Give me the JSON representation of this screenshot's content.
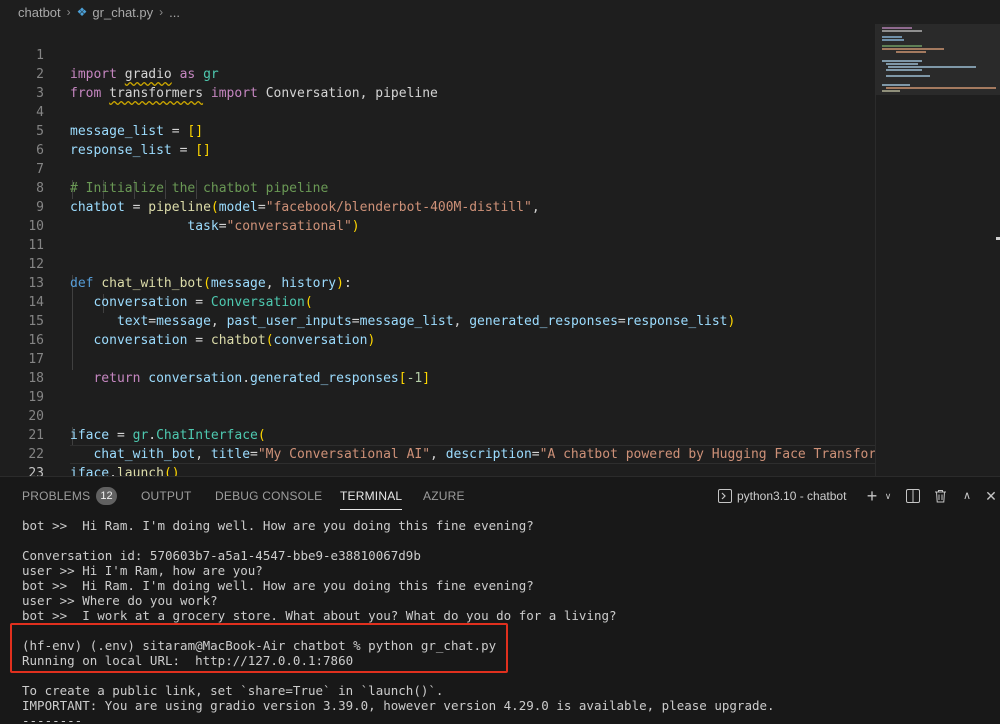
{
  "breadcrumb": {
    "folder": "chatbot",
    "file": "gr_chat.py",
    "more": "..."
  },
  "editor": {
    "active_line": 23,
    "lines": [
      {
        "n": "1"
      },
      {
        "n": "2"
      },
      {
        "n": "3"
      },
      {
        "n": "4"
      },
      {
        "n": "5"
      },
      {
        "n": "6"
      },
      {
        "n": "7"
      },
      {
        "n": "8"
      },
      {
        "n": "9"
      },
      {
        "n": "10"
      },
      {
        "n": "11"
      },
      {
        "n": "12"
      },
      {
        "n": "13"
      },
      {
        "n": "14"
      },
      {
        "n": "15"
      },
      {
        "n": "16"
      },
      {
        "n": "17"
      },
      {
        "n": "18"
      },
      {
        "n": "19"
      },
      {
        "n": "20"
      },
      {
        "n": "21"
      },
      {
        "n": "22"
      },
      {
        "n": "23"
      }
    ],
    "tokens": {
      "import": "import",
      "from": "from",
      "as": "as",
      "gradio": "gradio",
      "gr": "gr",
      "transformers": "transformers",
      "conv_pipeline": "Conversation, pipeline",
      "message_list": "message_list",
      "response_list": "response_list",
      "eq": " = ",
      "empty_list": "[]",
      "comment": "# Initialize the chatbot pipeline",
      "chatbot": "chatbot",
      "pipeline": "pipeline",
      "model_kw": "model",
      "model_val": "\"facebook/blenderbot-400M-distill\"",
      "task_kw": "task",
      "task_val": "\"conversational\"",
      "def": "def",
      "chat_with_bot": "chat_with_bot",
      "message": "message",
      "history": "history",
      "conversation": "conversation",
      "Conversation": "Conversation",
      "text_kw": "text",
      "past_kw": "past_user_inputs",
      "gen_kw": "generated_responses",
      "return": "return",
      "generated_responses": "generated_responses",
      "minus_one": "-1",
      "iface": "iface",
      "ChatInterface": "ChatInterface",
      "title_kw": "title",
      "title_val": "\"My Conversational AI\"",
      "desc_kw": "description",
      "desc_val": "\"A chatbot powered by Hugging Face Transforme",
      "launch": "launch"
    }
  },
  "panel": {
    "tabs": {
      "problems": "PROBLEMS",
      "problems_count": "12",
      "output": "OUTPUT",
      "debug_console": "DEBUG CONSOLE",
      "terminal": "TERMINAL",
      "azure": "AZURE"
    },
    "active_tab": "TERMINAL",
    "terminal_name": "python3.10 - chatbot",
    "terminal_lines": [
      "bot >>  Hi Ram. I'm doing well. How are you doing this fine evening?",
      "",
      "Conversation id: 570603b7-a5a1-4547-bbe9-e38810067d9b",
      "user >> Hi I'm Ram, how are you?",
      "bot >>  Hi Ram. I'm doing well. How are you doing this fine evening?",
      "user >> Where do you work?",
      "bot >>  I work at a grocery store. What about you? What do you do for a living?",
      "",
      "(hf-env) (.env) sitaram@MacBook-Air chatbot % python gr_chat.py",
      "Running on local URL:  http://127.0.0.1:7860",
      "",
      "To create a public link, set `share=True` in `launch()`.",
      "IMPORTANT: You are using gradio version 3.39.0, however version 4.29.0 is available, please upgrade.",
      "--------"
    ]
  },
  "colors": {
    "editor_bg": "#1e1e1e",
    "panel_bg": "#181818",
    "highlight_box": "#e0301e",
    "keyword": "#c586c0",
    "string": "#ce9178",
    "comment": "#6a9955",
    "function": "#dcdcaa",
    "variable": "#9cdcfe"
  }
}
